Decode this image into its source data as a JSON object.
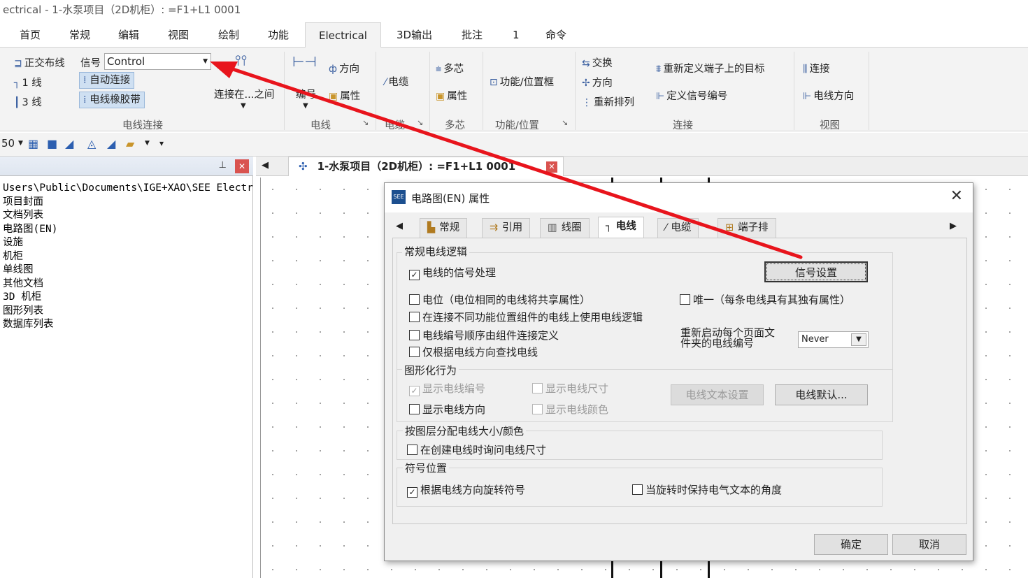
{
  "window": {
    "title": "ectrical - 1-水泵项目（2D机柜）: =F1+L1 0001"
  },
  "ribbon_tabs": [
    "首页",
    "常规",
    "编辑",
    "视图",
    "绘制",
    "功能",
    "Electrical",
    "3D输出",
    "批注",
    "1",
    "命令"
  ],
  "ribbon": {
    "wire_connect": {
      "ortho_label": "正交布线",
      "signal_label": "信号",
      "signal_value": "Control",
      "one_wire": "1 线",
      "three_wire": "3 线",
      "auto_connect": "自动连接",
      "rubber_band": "电线橡胶带",
      "connect_between": "连接在...之间",
      "group": "电线连接"
    },
    "wire": {
      "direction": "方向",
      "number": "编号",
      "properties": "属性",
      "group": "电线"
    },
    "cable": {
      "cable": "电缆",
      "group": "电缆"
    },
    "multicore": {
      "multicore": "多芯",
      "properties": "属性",
      "group": "多芯"
    },
    "function": {
      "frame": "功能/位置框",
      "group": "功能/位置"
    },
    "connect": {
      "swap": "交换",
      "direction": "方向",
      "reorder": "重新排列",
      "redefine_target": "重新定义端子上的目标",
      "define_signal": "定义信号编号",
      "group": "连接"
    },
    "view": {
      "connection": "连接",
      "wire_direction": "电线方向",
      "group": "视图"
    }
  },
  "toolbar": {
    "zoom": "50"
  },
  "left_panel": {
    "tree": [
      "Users\\Public\\Documents\\IGE+XAO\\SEE Electr",
      "项目封面",
      "文档列表",
      "电路图(EN)",
      "设施",
      "机柜",
      "单线图",
      "其他文档",
      "3D 机柜",
      "图形列表",
      "数据库列表"
    ]
  },
  "document_tab": {
    "title": "1-水泵项目（2D机柜）: =F1+L1 0001"
  },
  "dialog": {
    "title": "电路图(EN) 属性",
    "tabs": [
      "常规",
      "引用",
      "线圈",
      "电线",
      "电缆",
      "端子排"
    ],
    "active_tab": "电线",
    "general": {
      "label": "常规电线逻辑",
      "signal_processing": "电线的信号处理",
      "signal_settings": "信号设置",
      "potential": "电位（电位相同的电线将共享属性）",
      "unique": "唯一（每条电线具有其独有属性）",
      "diff_function": "在连接不同功能位置组件的电线上使用电线逻辑",
      "numbering_order": "电线编号顺序由组件连接定义",
      "find_by_direction": "仅根据电线方向查找电线",
      "restart_label_1": "重新启动每个页面文",
      "restart_label_2": "件夹的电线编号",
      "restart_value": "Never"
    },
    "graphic": {
      "label": "图形化行为",
      "show_number": "显示电线编号",
      "show_size": "显示电线尺寸",
      "show_direction": "显示电线方向",
      "show_color": "显示电线颜色",
      "text_settings": "电线文本设置",
      "wire_default": "电线默认..."
    },
    "layer": {
      "label": "按图层分配电线大小/颜色",
      "ask_size": "在创建电线时询问电线尺寸"
    },
    "symbol": {
      "label": "符号位置",
      "rotate": "根据电线方向旋转符号",
      "keep_angle": "当旋转时保持电气文本的角度"
    },
    "ok": "确定",
    "cancel": "取消"
  },
  "colors": {
    "arrow": "#e8141c",
    "accent": "#2d5fb0",
    "close_red": "#d9534f"
  }
}
